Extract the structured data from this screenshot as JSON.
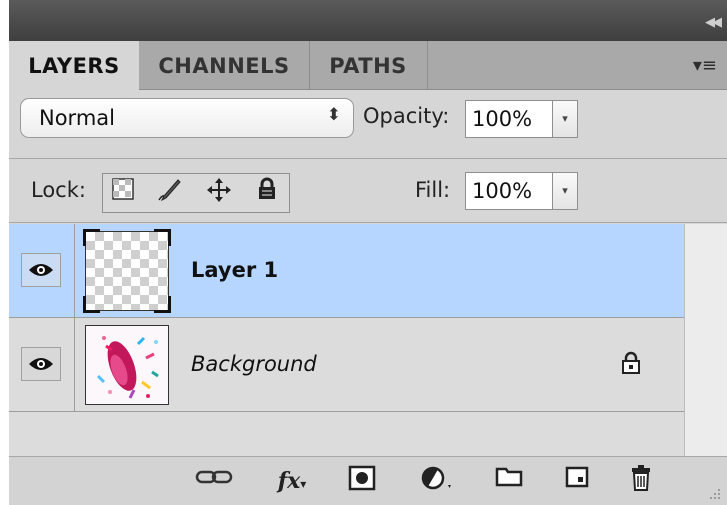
{
  "tabs": {
    "layers": "LAYERS",
    "channels": "CHANNELS",
    "paths": "PATHS"
  },
  "blend": {
    "mode": "Normal",
    "opacity_label": "Opacity:",
    "opacity_value": "100%"
  },
  "lock": {
    "label": "Lock:",
    "fill_label": "Fill:",
    "fill_value": "100%"
  },
  "layers": [
    {
      "name": "Layer 1",
      "visible": true,
      "selected": true,
      "locked": false
    },
    {
      "name": "Background",
      "visible": true,
      "selected": false,
      "locked": true
    }
  ],
  "footer_icons": [
    "link-layers-icon",
    "fx-icon",
    "layer-mask-icon",
    "adjustment-layer-icon",
    "folder-icon",
    "new-layer-icon",
    "trash-icon"
  ],
  "colors": {
    "selected_row": "#b6d6ff",
    "panel_bg": "#d6d6d6"
  }
}
